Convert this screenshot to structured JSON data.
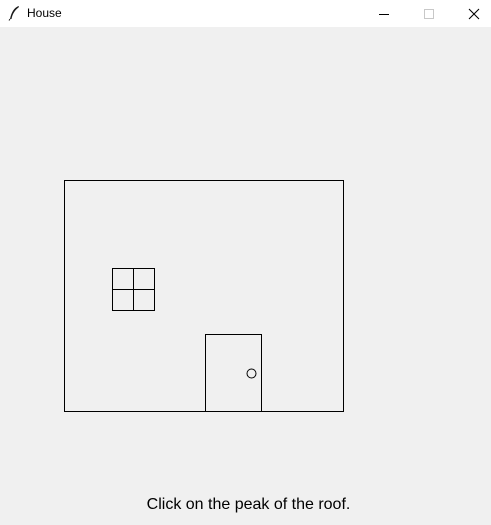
{
  "window": {
    "title": "House",
    "controls": {
      "minimize_icon": "minimize-icon",
      "maximize_icon": "maximize-icon",
      "close_icon": "close-icon"
    }
  },
  "canvas": {
    "background": "#f0f0f0",
    "stroke": "#000000"
  },
  "status_text": "Click on the peak of the roof."
}
